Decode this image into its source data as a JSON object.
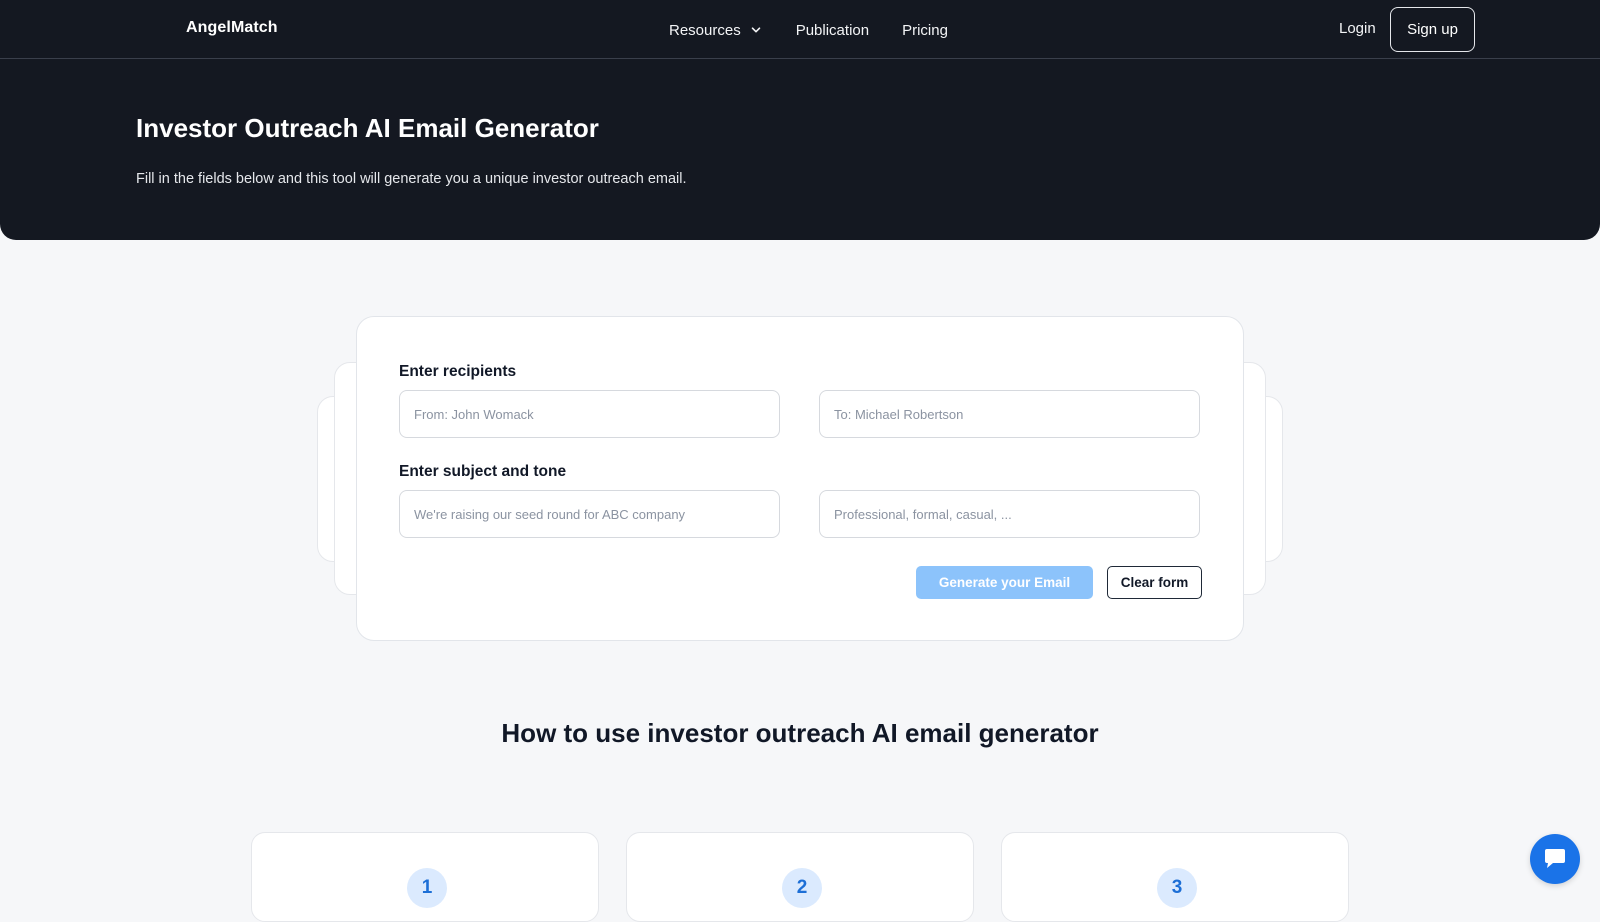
{
  "nav": {
    "brand": "AngelMatch",
    "links": {
      "resources": "Resources",
      "publication": "Publication",
      "pricing": "Pricing"
    },
    "login": "Login",
    "signup": "Sign up"
  },
  "hero": {
    "title": "Investor Outreach AI Email Generator",
    "subtitle": "Fill in the fields below and this tool will generate you a unique investor outreach email."
  },
  "form": {
    "recipients_label": "Enter recipients",
    "from": {
      "value": "",
      "placeholder": "From: John Womack"
    },
    "to": {
      "value": "",
      "placeholder": "To: Michael Robertson"
    },
    "subject_label": "Enter subject and tone",
    "subject": {
      "value": "",
      "placeholder": "We're raising our seed round for ABC company"
    },
    "tone": {
      "value": "",
      "placeholder": "Professional, formal, casual, ..."
    },
    "generate_label": "Generate your Email",
    "clear_label": "Clear form"
  },
  "howto": {
    "title": "How to use investor outreach AI email generator",
    "steps": [
      "1",
      "2",
      "3"
    ]
  },
  "icons": {
    "resources_chevron": "chevron-down-icon",
    "chat": "chat-icon"
  },
  "colors": {
    "hero_bg": "#141821",
    "page_bg": "#f6f7f9",
    "generate_button": "#8cc3fb",
    "step_badge_bg": "#dbeafe",
    "step_badge_text": "#1d6fd6",
    "chat_bubble": "#1a73e8"
  }
}
